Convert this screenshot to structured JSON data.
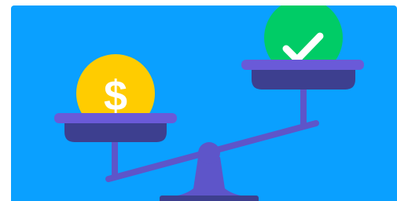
{
  "illustration": {
    "background_color": "#0aa0ff",
    "coin_color": "#ffcc00",
    "check_badge_color": "#00cc66",
    "pan_color": "#6a5ad8",
    "pan_shadow_color": "#3d3f8f",
    "beam_color": "#5e55c9",
    "left_icon": "dollar-sign-icon",
    "right_icon": "checkmark-icon",
    "coin_symbol": "$"
  }
}
